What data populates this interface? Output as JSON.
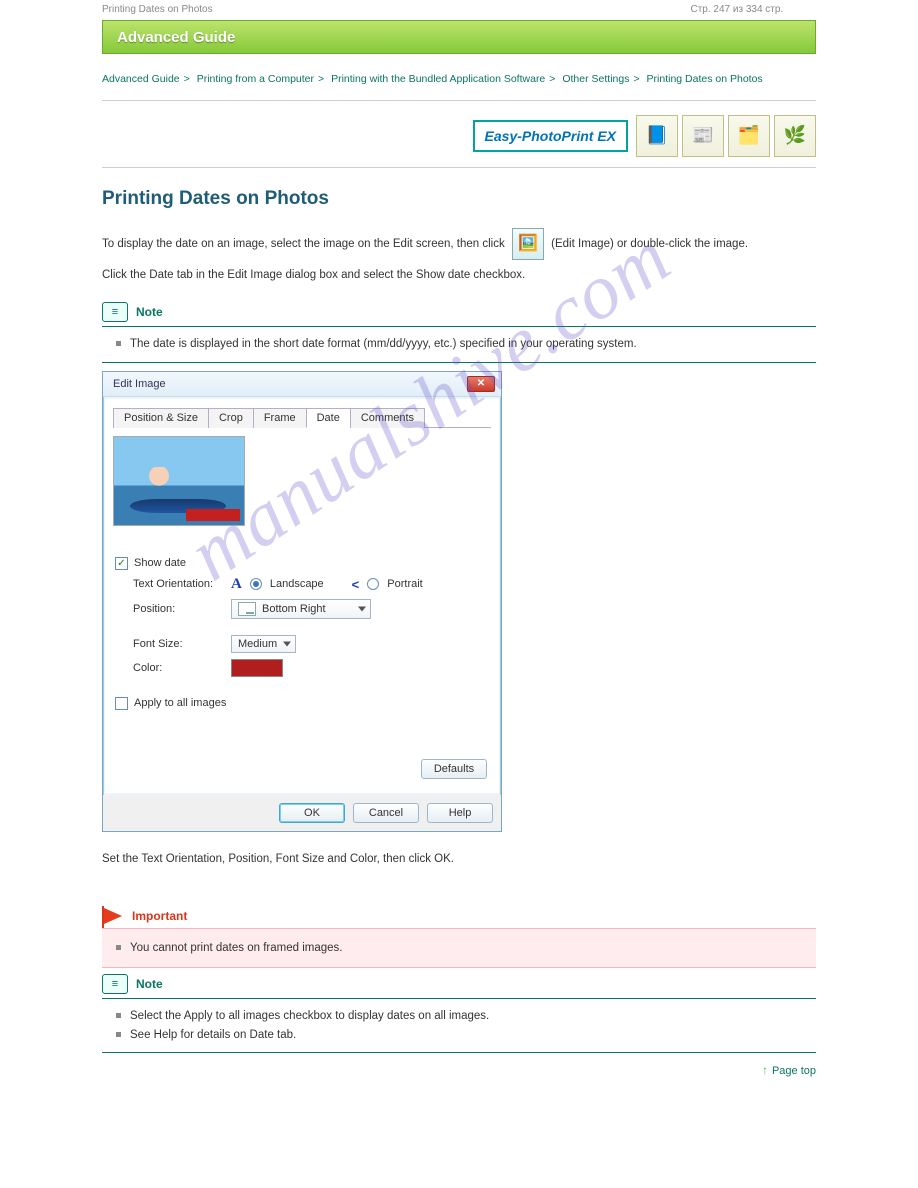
{
  "pageHeader": {
    "label": "Printing Dates on Photos",
    "pageStr": "Стр. 247 из 334 стр."
  },
  "banner": {
    "title": "Advanced Guide"
  },
  "breadcrumb": {
    "items": [
      "Advanced Guide",
      "Printing from a Computer",
      "Printing with the Bundled Application Software",
      "Other Settings",
      "Printing Dates on Photos"
    ]
  },
  "badge": "Easy-PhotoPrint EX",
  "heading": "Printing Dates on Photos",
  "intro": {
    "line1": "To display the date on an image, select the image on the Edit screen, then click",
    "btnLabel": "(Edit Image) or",
    "line1b": "double-click the image.",
    "line2": "Click the Date tab in the Edit Image dialog box and select the Show date checkbox."
  },
  "note1": {
    "title": "Note",
    "items": [
      "The date is displayed in the short date format (mm/dd/yyyy, etc.) specified in your operating system."
    ]
  },
  "dialog": {
    "title": "Edit Image",
    "tabs": [
      "Position & Size",
      "Crop",
      "Frame",
      "Date",
      "Comments"
    ],
    "activeTab": 3,
    "showDate": {
      "label": "Show date",
      "checked": true
    },
    "orientation": {
      "label": "Text Orientation:",
      "landscape": "Landscape",
      "portrait": "Portrait",
      "selected": "landscape"
    },
    "position": {
      "label": "Position:",
      "value": "Bottom Right"
    },
    "fontSize": {
      "label": "Font Size:",
      "value": "Medium"
    },
    "color": {
      "label": "Color:",
      "value": "#b01f1e"
    },
    "applyAll": {
      "label": "Apply to all images",
      "checked": false
    },
    "buttons": {
      "defaults": "Defaults",
      "ok": "OK",
      "cancel": "Cancel",
      "help": "Help"
    }
  },
  "afterDialog": "Set the Text Orientation, Position, Font Size and Color, then click OK.",
  "important": {
    "title": "Important",
    "items": [
      "You cannot print dates on framed images."
    ]
  },
  "note2": {
    "title": "Note",
    "items": [
      "Select the Apply to all images checkbox to display dates on all images.",
      "See Help for details on Date tab."
    ]
  },
  "pageTop": "Page top",
  "watermark": "manualshive.com"
}
